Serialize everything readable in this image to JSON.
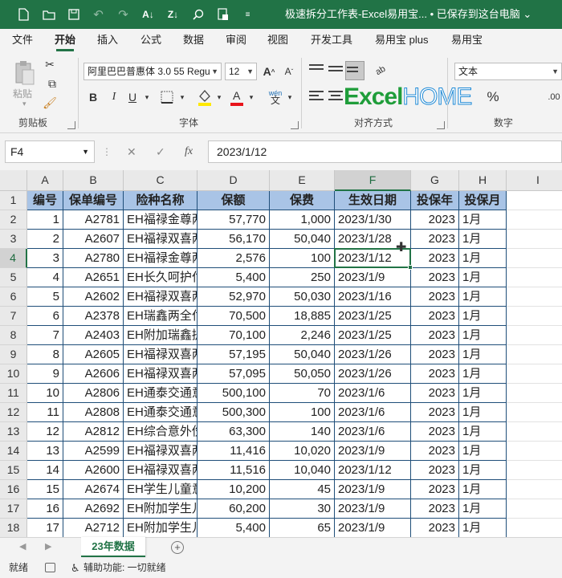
{
  "titlebar": {
    "title": "极速拆分工作表-Excel易用宝... • 已保存到这台电脑 ⌄",
    "icons": [
      "new-file-icon",
      "open-folder-icon",
      "save-icon",
      "undo-icon",
      "redo-icon",
      "sort-icon",
      "search-icon",
      "screenshot-icon",
      "dropdown-icon"
    ]
  },
  "menu": {
    "tabs": [
      "文件",
      "开始",
      "插入",
      "公式",
      "数据",
      "审阅",
      "视图",
      "开发工具",
      "易用宝 plus",
      "易用宝"
    ],
    "active": "开始"
  },
  "ribbon": {
    "clipboard": {
      "label": "剪贴板",
      "paste_label": "粘贴"
    },
    "font": {
      "label": "字体",
      "font_name": "阿里巴巴普惠体 3.0 55 Regu",
      "font_size": "12",
      "bold": "B",
      "italic": "I",
      "underline": "U",
      "phonetic": "wén"
    },
    "alignment": {
      "label": "对齐方式"
    },
    "number": {
      "label": "数字",
      "format": "文本",
      "percent": "%"
    },
    "logo": "ExcelHOME"
  },
  "formula_bar": {
    "name_box": "F4",
    "cancel": "✕",
    "confirm": "✓",
    "fx": "fx",
    "value": "2023/1/12"
  },
  "grid": {
    "columns": [
      "A",
      "B",
      "C",
      "D",
      "E",
      "F",
      "G",
      "H",
      "I"
    ],
    "selected_column": "F",
    "selected_row": "4",
    "headers": [
      "编号",
      "保单编号",
      "险种名称",
      "保额",
      "保费",
      "生效日期",
      "投保年",
      "投保月"
    ],
    "rows": [
      [
        "1",
        "A2781",
        "EH福禄金尊两",
        "57,770",
        "1,000",
        "2023/1/30",
        "2023",
        "1月"
      ],
      [
        "2",
        "A2607",
        "EH福禄双喜两",
        "56,170",
        "50,040",
        "2023/1/28",
        "2023",
        "1月"
      ],
      [
        "3",
        "A2780",
        "EH福禄金尊两",
        "2,576",
        "100",
        "2023/1/12",
        "2023",
        "1月"
      ],
      [
        "4",
        "A2651",
        "EH长久呵护付",
        "5,400",
        "250",
        "2023/1/9",
        "2023",
        "1月"
      ],
      [
        "5",
        "A2602",
        "EH福禄双喜两",
        "52,970",
        "50,030",
        "2023/1/16",
        "2023",
        "1月"
      ],
      [
        "6",
        "A2378",
        "EH瑞鑫两全付",
        "70,500",
        "18,885",
        "2023/1/25",
        "2023",
        "1月"
      ],
      [
        "7",
        "A2403",
        "EH附加瑞鑫提",
        "70,100",
        "2,246",
        "2023/1/25",
        "2023",
        "1月"
      ],
      [
        "8",
        "A2605",
        "EH福禄双喜两",
        "57,195",
        "50,040",
        "2023/1/26",
        "2023",
        "1月"
      ],
      [
        "9",
        "A2606",
        "EH福禄双喜两",
        "57,095",
        "50,050",
        "2023/1/26",
        "2023",
        "1月"
      ],
      [
        "10",
        "A2806",
        "EH通泰交通意",
        "500,100",
        "70",
        "2023/1/6",
        "2023",
        "1月"
      ],
      [
        "11",
        "A2808",
        "EH通泰交通意",
        "500,300",
        "100",
        "2023/1/6",
        "2023",
        "1月"
      ],
      [
        "12",
        "A2812",
        "EH综合意外伤",
        "63,300",
        "140",
        "2023/1/6",
        "2023",
        "1月"
      ],
      [
        "13",
        "A2599",
        "EH福禄双喜两",
        "11,416",
        "10,020",
        "2023/1/9",
        "2023",
        "1月"
      ],
      [
        "14",
        "A2600",
        "EH福禄双喜两",
        "11,516",
        "10,040",
        "2023/1/12",
        "2023",
        "1月"
      ],
      [
        "15",
        "A2674",
        "EH学生儿童意",
        "10,200",
        "45",
        "2023/1/9",
        "2023",
        "1月"
      ],
      [
        "16",
        "A2692",
        "EH附加学生儿",
        "60,200",
        "30",
        "2023/1/9",
        "2023",
        "1月"
      ],
      [
        "17",
        "A2712",
        "EH附加学生儿",
        "5,400",
        "65",
        "2023/1/9",
        "2023",
        "1月"
      ]
    ]
  },
  "sheets": {
    "active": "23年数据"
  },
  "status": {
    "ready": "就绪",
    "accessibility": "辅助功能: 一切就绪"
  }
}
